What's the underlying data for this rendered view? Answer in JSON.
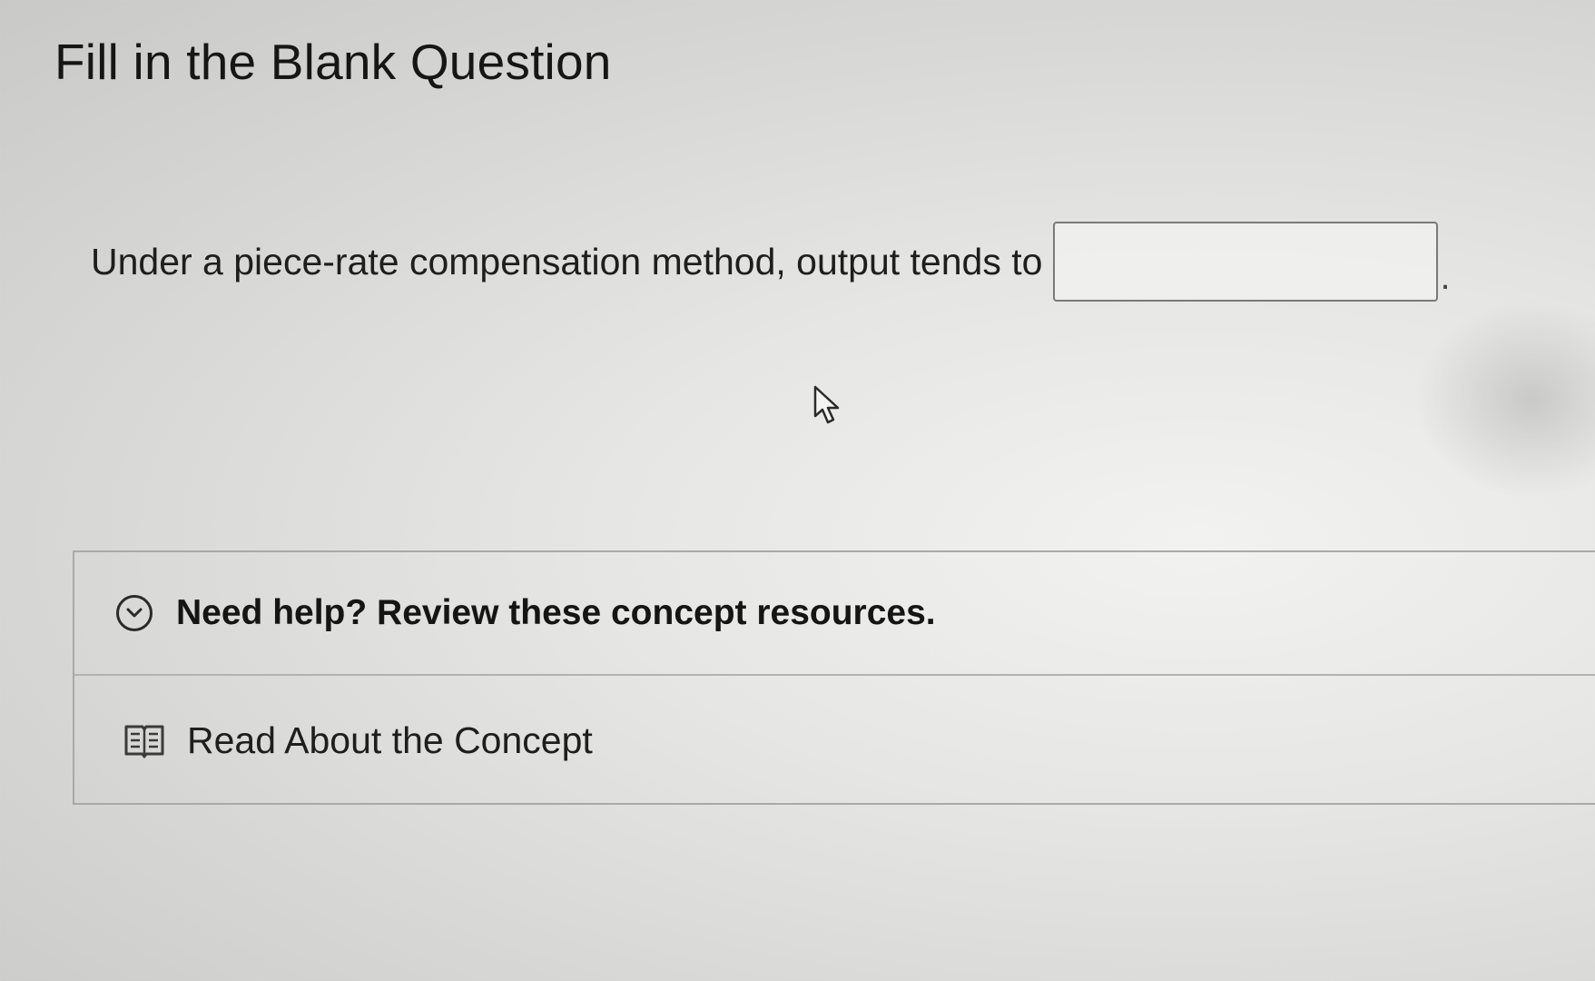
{
  "page": {
    "title": "Fill in the Blank Question"
  },
  "question": {
    "prompt": "Under a piece-rate compensation method, output tends to",
    "answer_value": "",
    "trailing_punctuation": "."
  },
  "resources": {
    "help_toggle_label": "Need help? Review these concept resources.",
    "help_toggle_icon": "chevron-down-circle-icon",
    "concept_link_label": "Read About the Concept",
    "concept_link_icon": "book-icon"
  },
  "colors": {
    "text": "#1a1a1a",
    "border": "#a9a9a7",
    "input_border": "#7a7a7a"
  }
}
